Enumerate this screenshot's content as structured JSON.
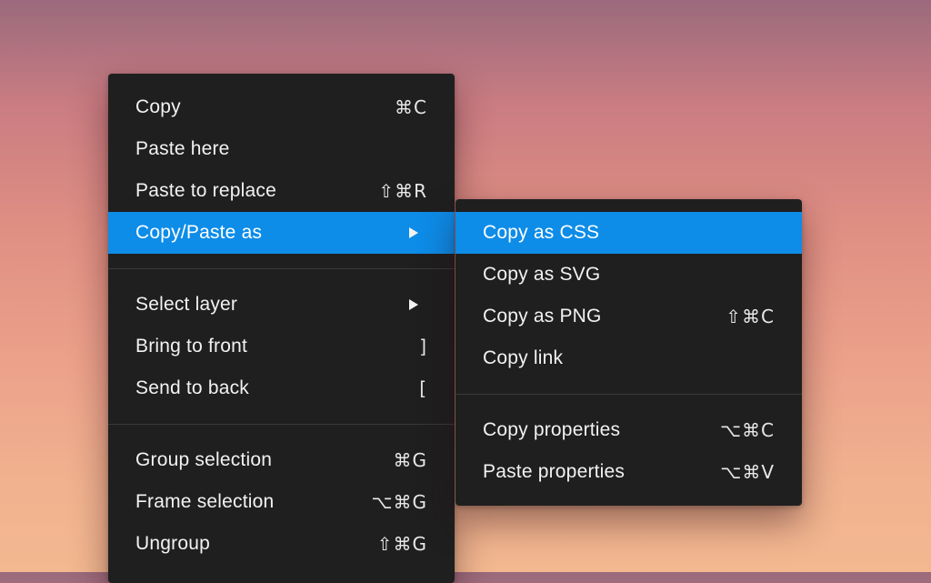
{
  "main_menu": {
    "items": [
      {
        "label": "Copy",
        "shortcut": "⌘C"
      },
      {
        "label": "Paste here",
        "shortcut": ""
      },
      {
        "label": "Paste to replace",
        "shortcut": "⇧⌘R"
      },
      {
        "label": "Copy/Paste as",
        "shortcut": ""
      },
      {
        "label": "Select layer",
        "shortcut": ""
      },
      {
        "label": "Bring to front",
        "shortcut": "]"
      },
      {
        "label": "Send to back",
        "shortcut": "["
      },
      {
        "label": "Group selection",
        "shortcut": "⌘G"
      },
      {
        "label": "Frame selection",
        "shortcut": "⌥⌘G"
      },
      {
        "label": "Ungroup",
        "shortcut": "⇧⌘G"
      }
    ]
  },
  "sub_menu": {
    "items": [
      {
        "label": "Copy as CSS",
        "shortcut": ""
      },
      {
        "label": "Copy as SVG",
        "shortcut": ""
      },
      {
        "label": "Copy as PNG",
        "shortcut": "⇧⌘C"
      },
      {
        "label": "Copy link",
        "shortcut": ""
      },
      {
        "label": "Copy properties",
        "shortcut": "⌥⌘C"
      },
      {
        "label": "Paste properties",
        "shortcut": "⌥⌘V"
      }
    ]
  },
  "colors": {
    "menu_bg": "#1f1f1f",
    "highlight": "#0d8ce8",
    "text": "#f2f2f2",
    "separator": "#3a3a3a"
  }
}
